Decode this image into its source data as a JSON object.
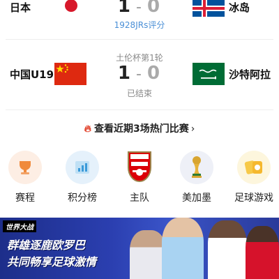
{
  "match1": {
    "home": "日本",
    "away": "冰岛",
    "home_score": "1",
    "separator": "-",
    "away_score": "0",
    "rating_link": "1928JRs评分"
  },
  "match2": {
    "competition": "土伦杯第1轮",
    "home": "中国U19",
    "away": "沙特阿拉",
    "home_score": "1",
    "separator": "-",
    "away_score": "0",
    "status": "已结束"
  },
  "hot_link": {
    "label": "查看近期3场热门比赛",
    "icon": "fire-icon",
    "chevron": "›"
  },
  "quick_nav": [
    {
      "label": "赛程",
      "icon": "trophy-cup-icon"
    },
    {
      "label": "积分榜",
      "icon": "standings-chart-icon"
    },
    {
      "label": "主队",
      "icon": "arsenal-crest-icon"
    },
    {
      "label": "美加墨",
      "icon": "world-cup-trophy-icon"
    },
    {
      "label": "足球游戏",
      "icon": "game-cards-icon"
    }
  ],
  "banner": {
    "tag": "世界大战",
    "line1": "群雄逐鹿欧罗巴",
    "line2": "共同畅享足球激情"
  },
  "colors": {
    "accent_blue": "#4a8fd6",
    "muted_gray": "#999999",
    "fire_red": "#e2452f"
  }
}
